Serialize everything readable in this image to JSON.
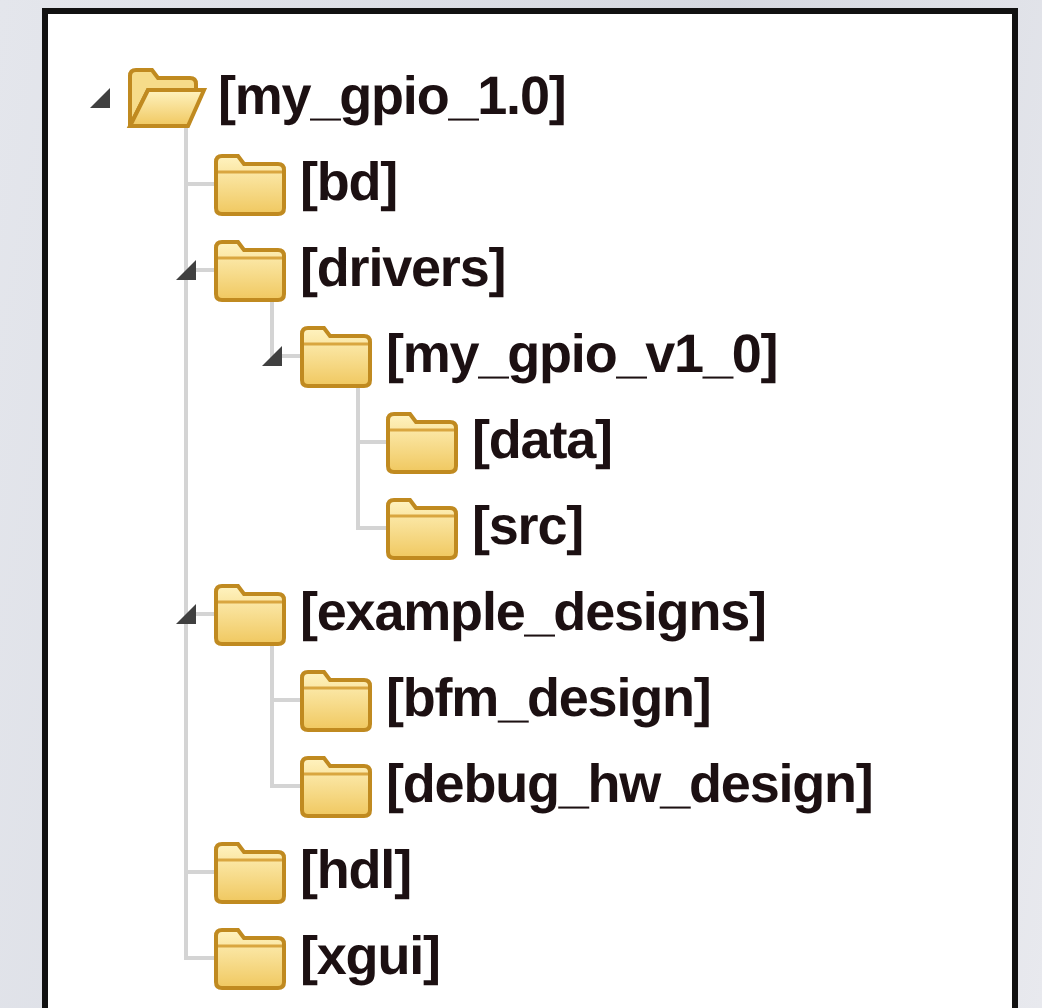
{
  "tree": [
    {
      "label": "[my_gpio_1.0]",
      "expanded": true,
      "children": [
        {
          "label": "[bd]"
        },
        {
          "label": "[drivers]",
          "expanded": true,
          "children": [
            {
              "label": "[my_gpio_v1_0]",
              "expanded": true,
              "children": [
                {
                  "label": "[data]"
                },
                {
                  "label": "[src]"
                }
              ]
            }
          ]
        },
        {
          "label": "[example_designs]",
          "expanded": true,
          "children": [
            {
              "label": "[bfm_design]"
            },
            {
              "label": "[debug_hw_design]"
            }
          ]
        },
        {
          "label": "[hdl]"
        },
        {
          "label": "[xgui]"
        }
      ]
    }
  ]
}
